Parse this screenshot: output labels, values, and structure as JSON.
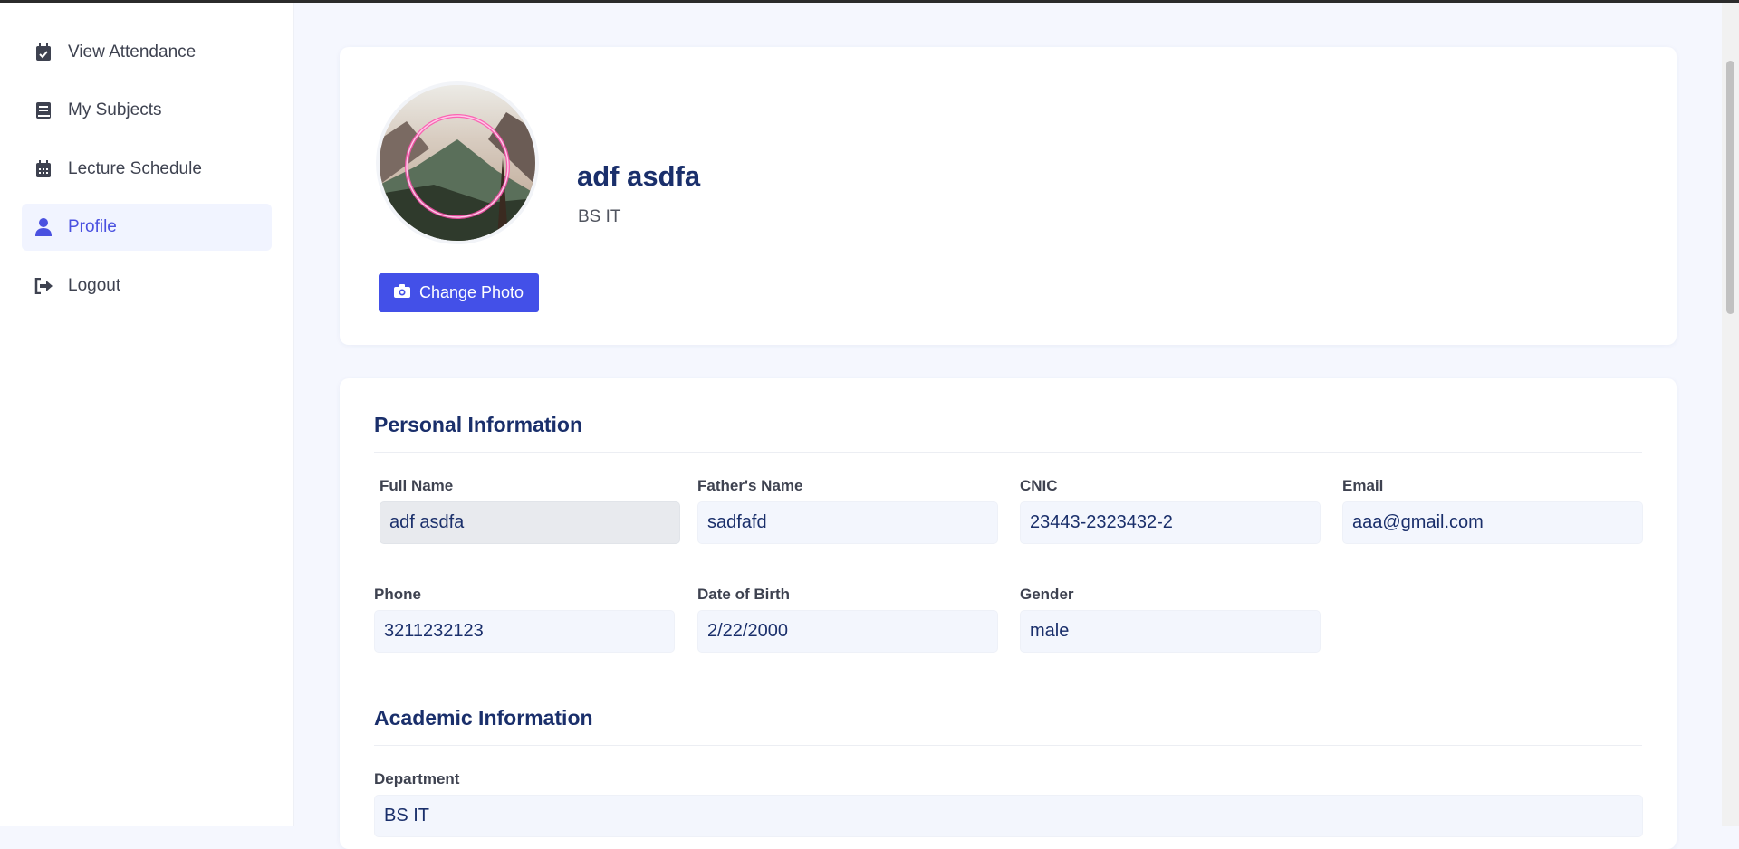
{
  "sidebar": {
    "items": [
      {
        "label": "View Attendance",
        "icon": "calendar-check-icon"
      },
      {
        "label": "My Subjects",
        "icon": "book-icon"
      },
      {
        "label": "Lecture Schedule",
        "icon": "calendar-icon"
      },
      {
        "label": "Profile",
        "icon": "user-icon",
        "active": true
      },
      {
        "label": "Logout",
        "icon": "logout-icon"
      }
    ]
  },
  "profile": {
    "name": "adf asdfa",
    "program": "BS IT",
    "change_photo_label": "Change Photo"
  },
  "personal_info": {
    "title": "Personal Information",
    "fields": {
      "full_name": {
        "label": "Full Name",
        "value": "adf asdfa"
      },
      "father_name": {
        "label": "Father's Name",
        "value": "sadfafd"
      },
      "cnic": {
        "label": "CNIC",
        "value": "23443-2323432-2"
      },
      "email": {
        "label": "Email",
        "value": "aaa@gmail.com"
      },
      "phone": {
        "label": "Phone",
        "value": "3211232123"
      },
      "dob": {
        "label": "Date of Birth",
        "value": "2/22/2000"
      },
      "gender": {
        "label": "Gender",
        "value": "male"
      }
    }
  },
  "academic_info": {
    "title": "Academic Information",
    "fields": {
      "department": {
        "label": "Department",
        "value": "BS IT"
      }
    }
  },
  "colors": {
    "accent": "#4350e8",
    "heading": "#1a2f6b",
    "active_bg": "#f1f4ff"
  }
}
